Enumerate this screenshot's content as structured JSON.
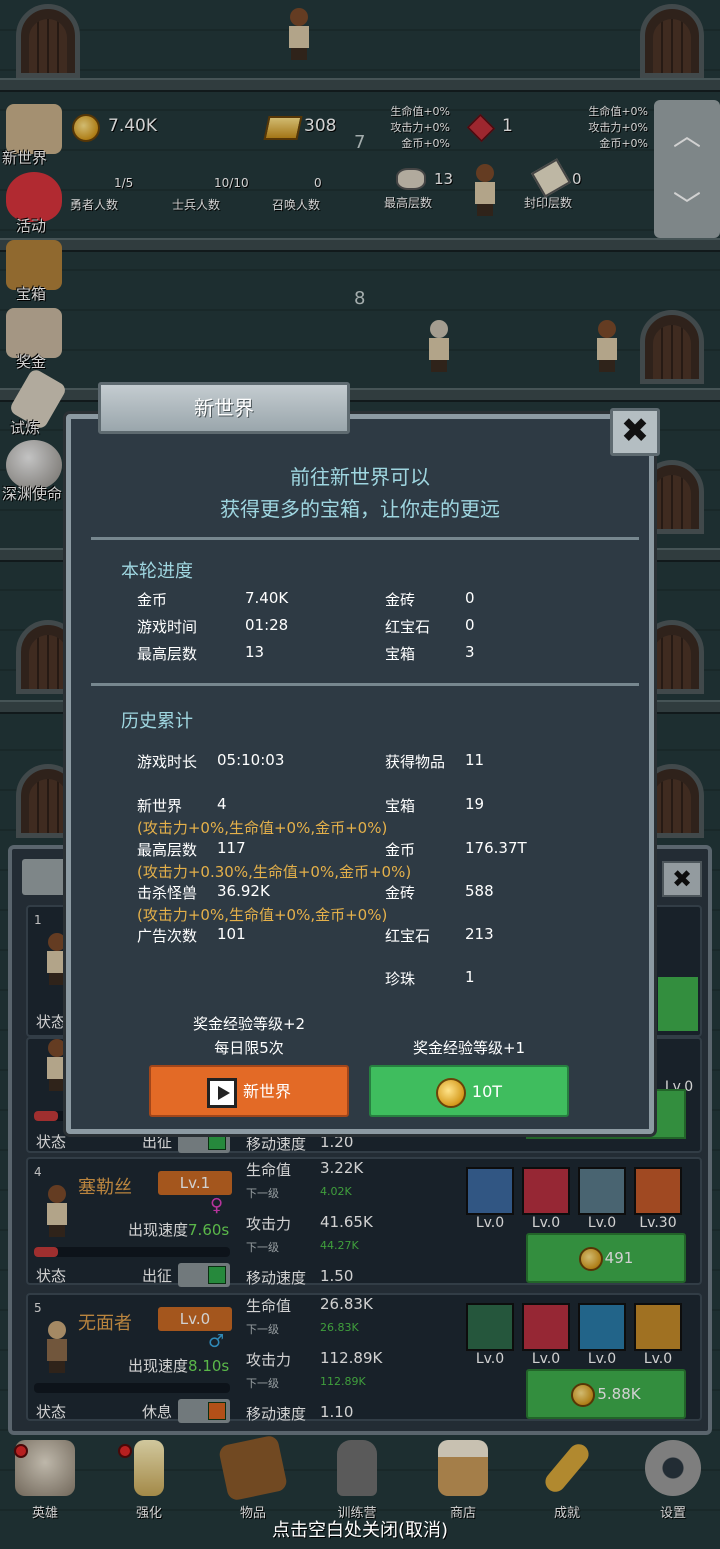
{
  "background": {
    "floor_numbers": [
      "7",
      "8"
    ]
  },
  "side_menu": [
    {
      "label": "新世界",
      "icon": "map-icon",
      "color": "#c8b08a"
    },
    {
      "label": "活动",
      "icon": "heart-icon",
      "color": "#d8343c"
    },
    {
      "label": "宝箱",
      "icon": "chest-icon",
      "color": "#b0803a"
    },
    {
      "label": "奖金",
      "icon": "envelope-icon",
      "color": "#c8b8a0"
    },
    {
      "label": "试炼",
      "icon": "feather-icon",
      "color": "#d8d0c0"
    },
    {
      "label": "深渊使命",
      "icon": "orb-icon",
      "color": "#b8b4ae"
    }
  ],
  "top_stats": {
    "gold": "7.40K",
    "gold_bars": "308",
    "ruby": "1",
    "gold_bonus": [
      "生命值+0%",
      "攻击力+0%",
      "金币+0%"
    ],
    "ruby_bonus": [
      "生命值+0%",
      "攻击力+0%",
      "金币+0%"
    ],
    "hero_count": {
      "value": "1/5",
      "label": "勇者人数"
    },
    "soldier_count": {
      "value": "10/10",
      "label": "士兵人数"
    },
    "summon_count": {
      "value": "0",
      "label": "召唤人数"
    },
    "max_floor": {
      "value": "13",
      "label": "最高层数"
    },
    "seal_floor": {
      "value": "0",
      "label": "封印层数"
    },
    "arrow_up": "︿",
    "arrow_down": "﹀"
  },
  "modal": {
    "title": "新世界",
    "close": "✖",
    "subtitle_1": "前往新世界可以",
    "subtitle_2": "获得更多的宝箱，让你走的更远",
    "current": {
      "heading": "本轮进度",
      "rows": [
        {
          "l1": "金币",
          "v1": "7.40K",
          "l2": "金砖",
          "v2": "0"
        },
        {
          "l1": "游戏时间",
          "v1": "01:28",
          "l2": "红宝石",
          "v2": "0"
        },
        {
          "l1": "最高层数",
          "v1": "13",
          "l2": "宝箱",
          "v2": "3"
        }
      ]
    },
    "history": {
      "heading": "历史累计",
      "play_time_label": "游戏时长",
      "play_time": "05:10:03",
      "items_label": "获得物品",
      "items": "11",
      "new_world_label": "新世界",
      "new_world": "4",
      "chest_label": "宝箱",
      "chest": "19",
      "bonus_1": "(攻击力+0%,生命值+0%,金币+0%)",
      "max_floor_label": "最高层数",
      "max_floor": "117",
      "gold_label": "金币",
      "gold": "176.37T",
      "bonus_2": "(攻击力+0.30%,生命值+0%,金币+0%)",
      "kills_label": "击杀怪兽",
      "kills": "36.92K",
      "bricks_label": "金砖",
      "bricks": "588",
      "bonus_3": "(攻击力+0%,生命值+0%,金币+0%)",
      "ads_label": "广告次数",
      "ads": "101",
      "ruby_label": "红宝石",
      "ruby": "213",
      "pearl_label": "珍珠",
      "pearl": "1"
    },
    "note_left_1": "奖金经验等级+2",
    "note_left_2": "每日限5次",
    "note_right": "奖金经验等级+1",
    "btn_ad": "新世界",
    "btn_gold": "10T"
  },
  "heroes_partial": {
    "first_index": "1",
    "first_status": "状态",
    "second_status": "状态",
    "second_action": "出征",
    "second_move_label": "移动速度",
    "second_move": "1.20",
    "second_lv": "Lv.0"
  },
  "heroes": [
    {
      "index": "4",
      "name": "塞勒丝",
      "lv": "Lv.1",
      "gender": "♀",
      "gender_color": "#e040c0",
      "speed_label": "出现速度",
      "speed": "7.60s",
      "status": "状态",
      "action": "出征",
      "active": true,
      "hp_label": "生命值",
      "hp": "3.22K",
      "next_label": "下一级",
      "hp_next": "4.02K",
      "atk_label": "攻击力",
      "atk": "41.65K",
      "atk_next": "44.27K",
      "move_label": "移动速度",
      "move": "1.50",
      "equip": [
        {
          "lv": "Lv.0",
          "icon": "shield-icon",
          "color": "#3c6aa0"
        },
        {
          "lv": "Lv.0",
          "icon": "beast-icon",
          "color": "#b83040"
        },
        {
          "lv": "Lv.0",
          "icon": "boots-icon",
          "color": "#5a7a8a"
        },
        {
          "lv": "Lv.30",
          "icon": "spider-icon",
          "color": "#c45a2a"
        }
      ],
      "cost": "491"
    },
    {
      "index": "5",
      "name": "无面者",
      "lv": "Lv.0",
      "gender": "♂",
      "gender_color": "#3aa8e0",
      "speed_label": "出现速度",
      "speed": "8.10s",
      "status": "状态",
      "action": "休息",
      "active": false,
      "hp_label": "生命值",
      "hp": "26.83K",
      "next_label": "下一级",
      "hp_next": "26.83K",
      "atk_label": "攻击力",
      "atk": "112.89K",
      "atk_next": "112.89K",
      "move_label": "移动速度",
      "move": "1.10",
      "equip": [
        {
          "lv": "Lv.0",
          "icon": "sword-shield-icon",
          "color": "#2e6a4a"
        },
        {
          "lv": "Lv.0",
          "icon": "blade-icon",
          "color": "#b83040"
        },
        {
          "lv": "Lv.0",
          "icon": "gauntlet-icon",
          "color": "#2a7aa8"
        },
        {
          "lv": "Lv.0",
          "icon": "helmet-icon",
          "color": "#c48a2a"
        }
      ],
      "cost": "5.88K"
    }
  ],
  "bottom_nav": [
    {
      "label": "英雄",
      "icon": "skull-icon",
      "dot": true,
      "color": "#d8cfc0"
    },
    {
      "label": "强化",
      "icon": "candle-icon",
      "dot": true,
      "color": "#e8d8a8"
    },
    {
      "label": "物品",
      "icon": "book-icon",
      "dot": false,
      "color": "#8a5a2a"
    },
    {
      "label": "训练营",
      "icon": "lantern-icon",
      "dot": false,
      "color": "#8a8a8a"
    },
    {
      "label": "商店",
      "icon": "mug-icon",
      "dot": false,
      "color": "#c89a5a"
    },
    {
      "label": "成就",
      "icon": "key-icon",
      "dot": false,
      "color": "#d8a83a"
    },
    {
      "label": "设置",
      "icon": "gear-icon",
      "dot": false,
      "color": "#9a9a9a"
    }
  ],
  "close_hint": "点击空白处关闭(取消)"
}
